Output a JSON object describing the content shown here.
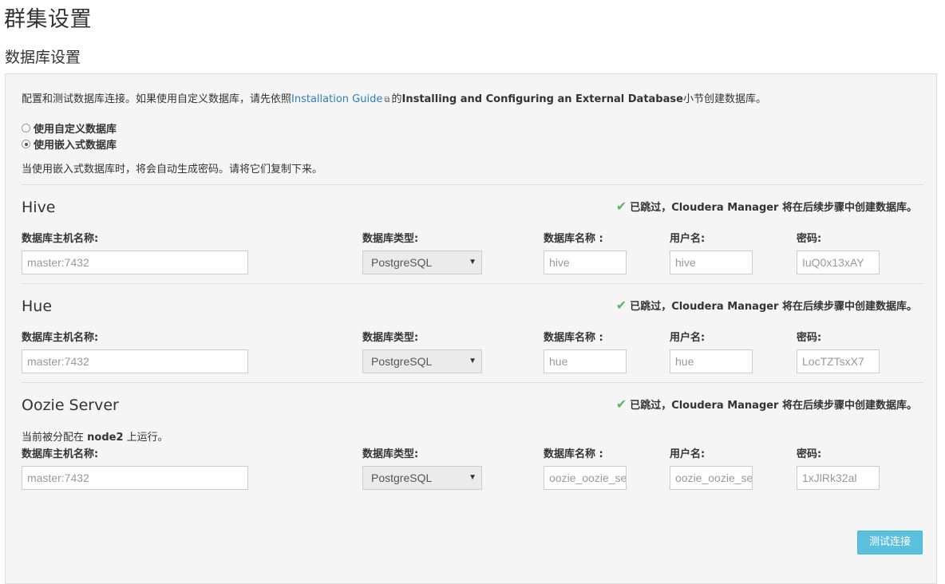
{
  "page": {
    "title": "群集设置",
    "section": "数据库设置"
  },
  "intro": {
    "prefix": "配置和测试数据库连接。如果使用自定义数据库，请先依照",
    "link": "Installation Guide",
    "mid": "的",
    "bold": "Installing and Configuring an External Database",
    "suffix": "小节创建数据库。"
  },
  "options": [
    {
      "label": "使用自定义数据库",
      "checked": false
    },
    {
      "label": "使用嵌入式数据库",
      "checked": true
    }
  ],
  "note": "当使用嵌入式数据库时，将会自动生成密码。请将它们复制下来。",
  "labels": {
    "host": "数据库主机名称:",
    "type": "数据库类型:",
    "dbname": "数据库名称 :",
    "user": "用户名:",
    "password": "密码:"
  },
  "services": [
    {
      "name": "Hive",
      "status": "已跳过，Cloudera Manager 将在后续步骤中创建数据库。",
      "host": "master:7432",
      "type": "PostgreSQL",
      "dbname": "hive",
      "user": "hive",
      "password": "IuQ0x13xAY"
    },
    {
      "name": "Hue",
      "status": "已跳过，Cloudera Manager 将在后续步骤中创建数据库。",
      "host": "master:7432",
      "type": "PostgreSQL",
      "dbname": "hue",
      "user": "hue",
      "password": "LocTZTsxX7"
    },
    {
      "name": "Oozie Server",
      "status": "已跳过，Cloudera Manager 将在后续步骤中创建数据库。",
      "assigned_prefix": "当前被分配在",
      "assigned_node": "node2",
      "assigned_suffix": "上运行。",
      "host": "master:7432",
      "type": "PostgreSQL",
      "dbname": "oozie_oozie_server",
      "user": "oozie_oozie_server",
      "password": "1xJlRk32al"
    }
  ],
  "test_button": "测试连接",
  "colors": {
    "accent": "#5bc0de",
    "link": "#2a7fb8",
    "success": "#5cb85c"
  },
  "icons": {
    "external": "external-link-icon",
    "check": "check-icon",
    "caret": "caret-down-icon"
  }
}
